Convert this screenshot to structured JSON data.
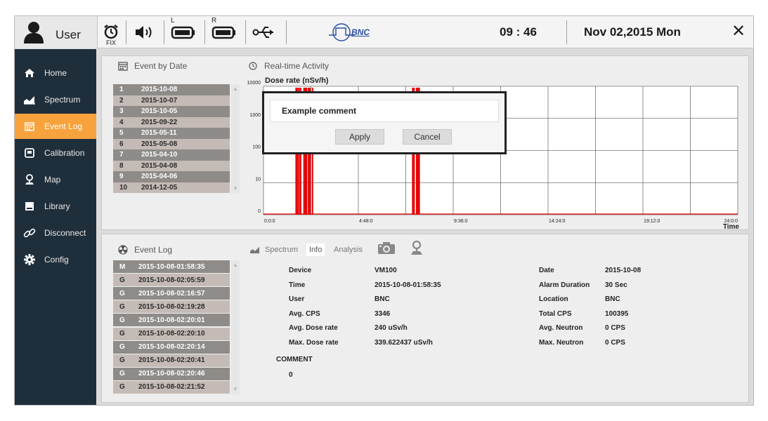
{
  "topbar": {
    "user_label": "User",
    "fix_label": "FIX",
    "left_label": "L",
    "right_label": "R",
    "bnc_label": "BNC",
    "time": "09 : 46",
    "date": "Nov 02,2015 Mon",
    "close_label": "✕"
  },
  "sidebar": {
    "items": [
      {
        "label": "Home",
        "icon": "home-icon"
      },
      {
        "label": "Spectrum",
        "icon": "spectrum-icon"
      },
      {
        "label": "Event Log",
        "icon": "calendar-icon",
        "active": true
      },
      {
        "label": "Calibration",
        "icon": "calibration-icon"
      },
      {
        "label": "Map",
        "icon": "map-pin-icon"
      },
      {
        "label": "Library",
        "icon": "library-icon"
      },
      {
        "label": "Disconnect",
        "icon": "link-icon"
      },
      {
        "label": "Config",
        "icon": "gear-icon"
      }
    ]
  },
  "event_by_date": {
    "title": "Event by Date",
    "rows": [
      {
        "n": "1",
        "date": "2015-10-08"
      },
      {
        "n": "2",
        "date": "2015-10-07"
      },
      {
        "n": "3",
        "date": "2015-10-05"
      },
      {
        "n": "4",
        "date": "2015-09-22"
      },
      {
        "n": "5",
        "date": "2015-05-11"
      },
      {
        "n": "6",
        "date": "2015-05-08"
      },
      {
        "n": "7",
        "date": "2015-04-10"
      },
      {
        "n": "8",
        "date": "2015-04-08"
      },
      {
        "n": "9",
        "date": "2015-04-06"
      },
      {
        "n": "10",
        "date": "2014-12-05"
      }
    ]
  },
  "realtime": {
    "title": "Real-time Activity"
  },
  "chart_data": {
    "type": "bar",
    "ylabel": "Dose rate (nSv/h)",
    "xlabel": "Time",
    "y_scale": "log",
    "ytick_labels": [
      "0",
      "10",
      "100",
      "1000",
      "10000"
    ],
    "xtick_labels": [
      "0:0:0",
      "4:48:0",
      "9:36:0",
      "14:24:0",
      "19:12:0",
      "24:0:0"
    ],
    "x_range_hours": [
      0,
      24
    ],
    "grid": true,
    "bar_color": "#e60000",
    "spikes_hours": [
      1.65,
      1.72,
      1.8,
      1.88,
      2.05,
      2.12,
      2.18,
      2.28,
      2.35,
      2.48,
      7.55,
      7.62,
      7.75,
      7.82,
      7.88
    ]
  },
  "event_log": {
    "title": "Event Log",
    "rows": [
      {
        "type": "M",
        "time": "2015-10-08-01:58:35"
      },
      {
        "type": "G",
        "time": "2015-10-08-02:05:59"
      },
      {
        "type": "G",
        "time": "2015-10-08-02:16:57"
      },
      {
        "type": "G",
        "time": "2015-10-08-02:19:28"
      },
      {
        "type": "G",
        "time": "2015-10-08-02:20:01"
      },
      {
        "type": "G",
        "time": "2015-10-08-02:20:10"
      },
      {
        "type": "G",
        "time": "2015-10-08-02:20:14"
      },
      {
        "type": "G",
        "time": "2015-10-08-02:20:41"
      },
      {
        "type": "G",
        "time": "2015-10-08-02:20:46"
      },
      {
        "type": "G",
        "time": "2015-10-08-02:21:52"
      }
    ]
  },
  "detail_tabs": {
    "spectrum": "Spectrum",
    "info": "Info",
    "analysis": "Analysis"
  },
  "info": {
    "left": [
      {
        "label": "Device",
        "value": "VM100"
      },
      {
        "label": "Time",
        "value": "2015-10-08-01:58:35"
      },
      {
        "label": "User",
        "value": "BNC"
      },
      {
        "label": "Avg. CPS",
        "value": "3346"
      },
      {
        "label": "Avg. Dose rate",
        "value": "240  uSv/h"
      },
      {
        "label": "Max. Dose rate",
        "value": "339.622437  uSv/h"
      }
    ],
    "right": [
      {
        "label": "Date",
        "value": "2015-10-08"
      },
      {
        "label": "Alarm Duration",
        "value": "30  Sec"
      },
      {
        "label": "Location",
        "value": "BNC"
      },
      {
        "label": "Total CPS",
        "value": "100395"
      },
      {
        "label": "Avg. Neutron",
        "value": "0  CPS"
      },
      {
        "label": "Max. Neutron",
        "value": "0  CPS"
      }
    ],
    "comment_label": "COMMENT",
    "comment_value": "0"
  },
  "dialog": {
    "comment_text": "Example comment",
    "apply_label": "Apply",
    "cancel_label": "Cancel"
  }
}
